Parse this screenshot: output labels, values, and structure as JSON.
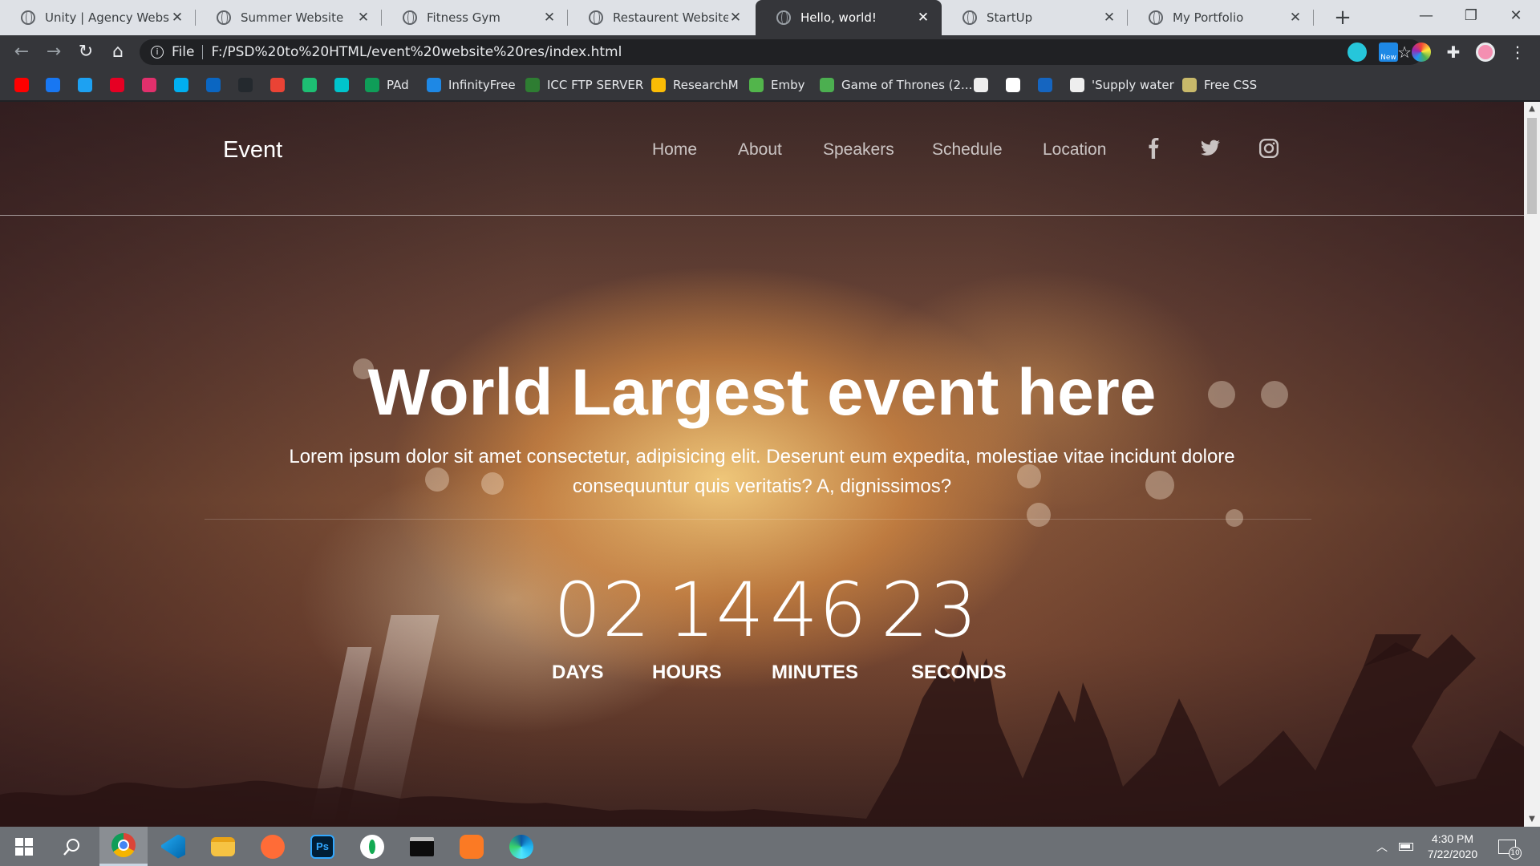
{
  "browser": {
    "tabs": [
      {
        "title": "Unity | Agency Website",
        "active": false
      },
      {
        "title": "Summer Website",
        "active": false
      },
      {
        "title": "Fitness Gym",
        "active": false
      },
      {
        "title": "Restaurent Website",
        "active": false
      },
      {
        "title": "Hello, world!",
        "active": true
      },
      {
        "title": "StartUp",
        "active": false
      },
      {
        "title": "My Portfolio",
        "active": false
      }
    ],
    "address": {
      "scheme": "File",
      "url": "F:/PSD%20to%20HTML/event%20website%20res/index.html"
    },
    "extensions": {
      "new_badge": "New"
    },
    "bookmarks": [
      {
        "label": "",
        "icon": "youtube-icon",
        "color": "#ff0000"
      },
      {
        "label": "",
        "icon": "facebook-icon",
        "color": "#1877f2"
      },
      {
        "label": "",
        "icon": "twitter-icon",
        "color": "#1da1f2"
      },
      {
        "label": "",
        "icon": "pinterest-icon",
        "color": "#e60023"
      },
      {
        "label": "",
        "icon": "instagram-icon",
        "color": "#e1306c"
      },
      {
        "label": "",
        "icon": "skype-icon",
        "color": "#00aff0"
      },
      {
        "label": "",
        "icon": "linkedin-icon",
        "color": "#0a66c2"
      },
      {
        "label": "",
        "icon": "github-icon",
        "color": "#24292e"
      },
      {
        "label": "",
        "icon": "gmail-icon",
        "color": "#ea4335"
      },
      {
        "label": "",
        "icon": "fiverr-icon",
        "color": "#1dbf73"
      },
      {
        "label": "",
        "icon": "canva-icon",
        "color": "#00c4cc"
      },
      {
        "label": "PAd",
        "icon": "google-drive-icon",
        "color": "#0f9d58"
      },
      {
        "label": "InfinityFree",
        "icon": "infinity-icon",
        "color": "#1e88e5"
      },
      {
        "label": "ICC FTP SERVER",
        "icon": "leaf-icon",
        "color": "#2e7d32"
      },
      {
        "label": "ResearchM",
        "icon": "researchm-icon",
        "color": "#fbbc05"
      },
      {
        "label": "Emby",
        "icon": "emby-icon",
        "color": "#52b54b"
      },
      {
        "label": "Game of Thrones (2...",
        "icon": "play-circle-icon",
        "color": "#4caf50"
      },
      {
        "label": "",
        "icon": "news-icon",
        "color": "#eeeeee"
      },
      {
        "label": "",
        "icon": "s-circle-icon",
        "color": "#ffffff"
      },
      {
        "label": "",
        "icon": "loop-icon",
        "color": "#1565c0"
      },
      {
        "label": "'Supply water",
        "icon": "doc-icon",
        "color": "#eeeeee"
      },
      {
        "label": "Free CSS",
        "icon": "folder-image-icon",
        "color": "#c8b96a"
      }
    ]
  },
  "site": {
    "brand": "Event",
    "menu": [
      "Home",
      "About",
      "Speakers",
      "Schedule",
      "Location"
    ],
    "social": [
      "facebook-icon",
      "twitter-icon",
      "instagram-icon"
    ],
    "hero": {
      "title": "World Largest event here",
      "text": "Lorem ipsum dolor sit amet consectetur, adipisicing elit. Deserunt eum expedita, molestiae vitae incidunt dolore consequuntur quis veritatis? A, dignissimos?"
    },
    "countdown": [
      {
        "value": "02",
        "label": "DAYS"
      },
      {
        "value": "14",
        "label": "HOURS"
      },
      {
        "value": "46",
        "label": "MINUTES"
      },
      {
        "value": "23",
        "label": "SECONDS"
      }
    ]
  },
  "taskbar": {
    "apps": [
      "windows-start-icon",
      "search-icon",
      "chrome-icon",
      "vscode-icon",
      "file-explorer-icon",
      "postman-icon",
      "photoshop-icon",
      "mongodb-compass-icon",
      "terminal-icon",
      "xampp-icon",
      "edge-icon"
    ],
    "time": "4:30 PM",
    "date": "7/22/2020",
    "notifications": "10"
  },
  "colors": {
    "accent_active_tab": "#35363a",
    "taskbar": "#6c7075",
    "hero_text": "#ffffff"
  }
}
